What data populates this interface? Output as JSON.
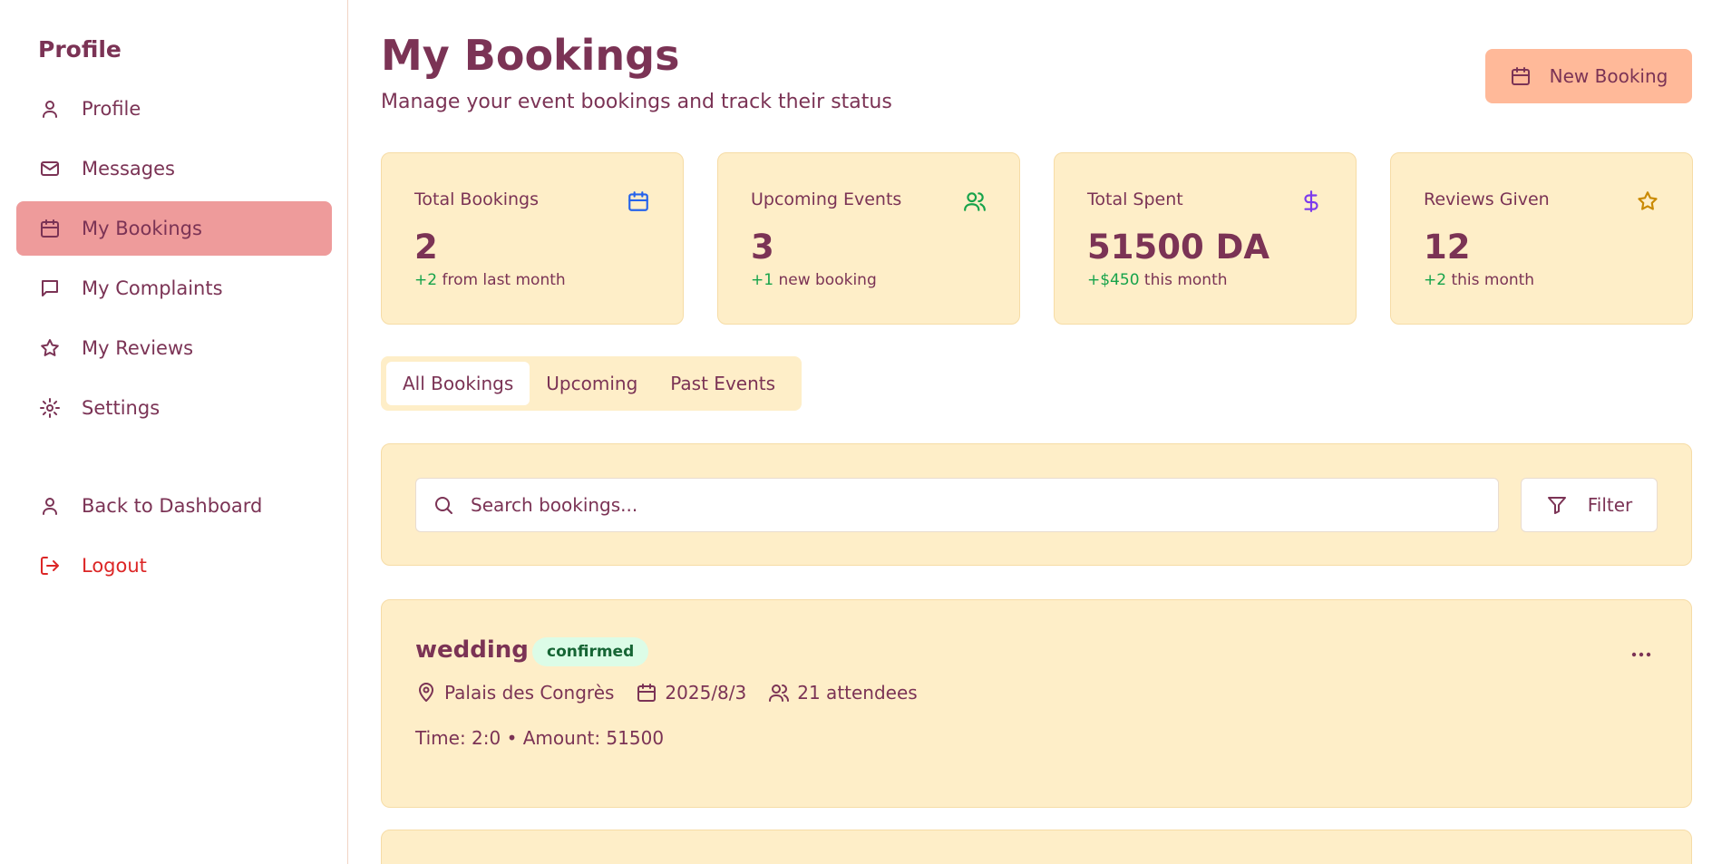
{
  "sidebar": {
    "title": "Profile",
    "items": [
      {
        "label": "Profile",
        "icon": "user-icon"
      },
      {
        "label": "Messages",
        "icon": "mail-icon"
      },
      {
        "label": "My Bookings",
        "icon": "calendar-icon",
        "active": true
      },
      {
        "label": "My Complaints",
        "icon": "message-square-icon"
      },
      {
        "label": "My Reviews",
        "icon": "star-icon"
      },
      {
        "label": "Settings",
        "icon": "gear-icon"
      }
    ],
    "back_label": "Back to Dashboard",
    "logout_label": "Logout"
  },
  "header": {
    "title": "My Bookings",
    "subtitle": "Manage your event bookings and track their status",
    "new_booking_label": "New Booking"
  },
  "stats": [
    {
      "label": "Total Bookings",
      "value": "2",
      "delta": "+2",
      "suffix": " from last month",
      "icon": "calendar-icon",
      "icon_color": "#2563eb"
    },
    {
      "label": "Upcoming Events",
      "value": "3",
      "delta": "+1",
      "suffix": " new booking",
      "icon": "users-icon",
      "icon_color": "#16a34a"
    },
    {
      "label": "Total Spent",
      "value": "51500 DA",
      "delta": "+$450",
      "suffix": " this month",
      "icon": "dollar-icon",
      "icon_color": "#7c3aed"
    },
    {
      "label": "Reviews Given",
      "value": "12",
      "delta": "+2",
      "suffix": " this month",
      "icon": "star-icon",
      "icon_color": "#ca8a04"
    }
  ],
  "tabs": [
    {
      "label": "All Bookings",
      "active": true
    },
    {
      "label": "Upcoming"
    },
    {
      "label": "Past Events"
    }
  ],
  "search": {
    "placeholder": "Search bookings...",
    "filter_label": "Filter"
  },
  "bookings": [
    {
      "title": "wedding",
      "status": "confirmed",
      "location": "Palais des Congrès",
      "date": "2025/8/3",
      "attendees": "21 attendees",
      "details": "Time: 2:0 • Amount: 51500"
    }
  ],
  "colors": {
    "primary_text": "#7b3355",
    "card_bg": "#feeec8",
    "active_nav": "#ee9b9b",
    "cta": "#ffb999",
    "positive": "#16a34a",
    "logout": "#dc2626"
  }
}
